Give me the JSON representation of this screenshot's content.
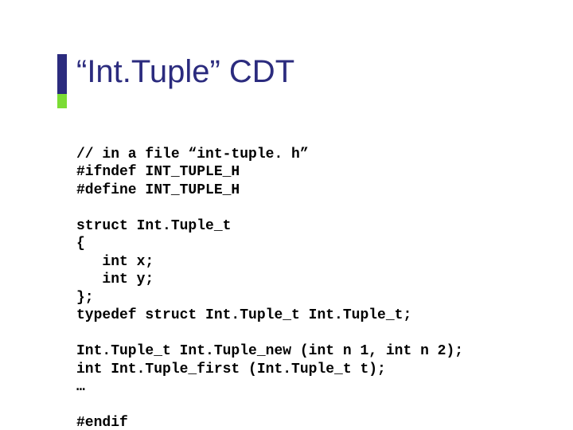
{
  "title": "“Int.Tuple” CDT",
  "code": {
    "l1": "// in a file “int-tuple. h”",
    "l2": "#ifndef INT_TUPLE_H",
    "l3": "#define INT_TUPLE_H",
    "l4": "",
    "l5": "struct Int.Tuple_t",
    "l6": "{",
    "l7": "   int x;",
    "l8": "   int y;",
    "l9": "};",
    "l10": "typedef struct Int.Tuple_t Int.Tuple_t;",
    "l11": "",
    "l12": "Int.Tuple_t Int.Tuple_new (int n 1, int n 2);",
    "l13": "int Int.Tuple_first (Int.Tuple_t t);",
    "l14": "…",
    "l15": "",
    "l16": "#endif"
  }
}
